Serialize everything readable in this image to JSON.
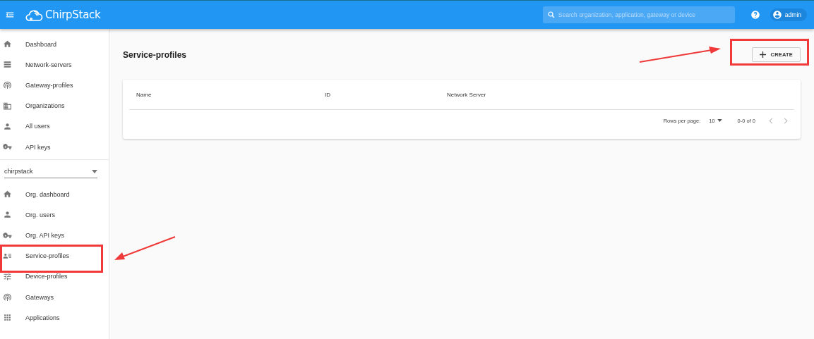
{
  "topbar": {
    "brand": "ChirpStack",
    "search": {
      "placeholder": "Search organization, application, gateway or device"
    },
    "user": "admin"
  },
  "sidebar": {
    "admin_items": [
      {
        "label": "Dashboard"
      },
      {
        "label": "Network-servers"
      },
      {
        "label": "Gateway-profiles"
      },
      {
        "label": "Organizations"
      },
      {
        "label": "All users"
      },
      {
        "label": "API keys"
      }
    ],
    "organization_select": {
      "value": "chirpstack"
    },
    "org_items": [
      {
        "label": "Org. dashboard"
      },
      {
        "label": "Org. users"
      },
      {
        "label": "Org. API keys"
      },
      {
        "label": "Service-profiles"
      },
      {
        "label": "Device-profiles"
      },
      {
        "label": "Gateways"
      },
      {
        "label": "Applications"
      }
    ]
  },
  "page": {
    "title": "Service-profiles",
    "create_button": "CREATE",
    "table": {
      "columns": [
        "Name",
        "ID",
        "Network Server"
      ],
      "pagination": {
        "rows_per_page_label": "Rows per page:",
        "rows_per_page": "10",
        "range": "0-0 of 0"
      }
    }
  }
}
